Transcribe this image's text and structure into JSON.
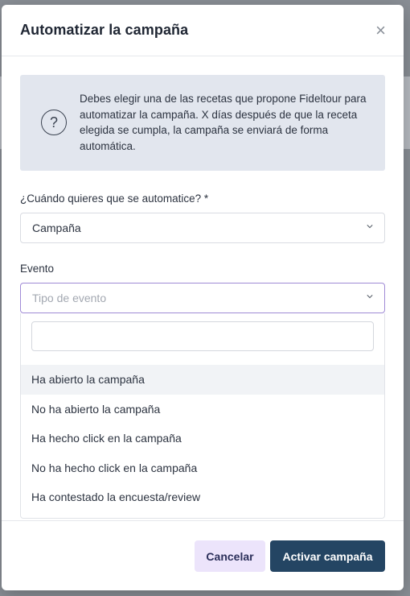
{
  "modal": {
    "title": "Automatizar la campaña",
    "close_icon": "×"
  },
  "info": {
    "icon": "?",
    "text": "Debes elegir una de las recetas que propone Fideltour para automatizar la campaña. X días después de que la receta elegida se cumpla, la campaña se enviará de forma automática."
  },
  "form": {
    "when_label": "¿Cuándo quieres que se automatice? *",
    "when_value": "Campaña",
    "event_label": "Evento",
    "event_placeholder": "Tipo de evento"
  },
  "dropdown": {
    "search_value": "",
    "options": [
      "Ha abierto la campaña",
      "No ha abierto la campaña",
      "Ha hecho click en la campaña",
      "No ha hecho click en la campaña",
      "Ha contestado la encuesta/review"
    ],
    "highlighted_index": 0
  },
  "footer": {
    "cancel_label": "Cancelar",
    "activate_label": "Activar campaña"
  },
  "colors": {
    "primary": "#244563",
    "secondary_bg": "#ece4fb",
    "focus_border": "#a08bd6",
    "info_bg": "#e2e6ee"
  }
}
